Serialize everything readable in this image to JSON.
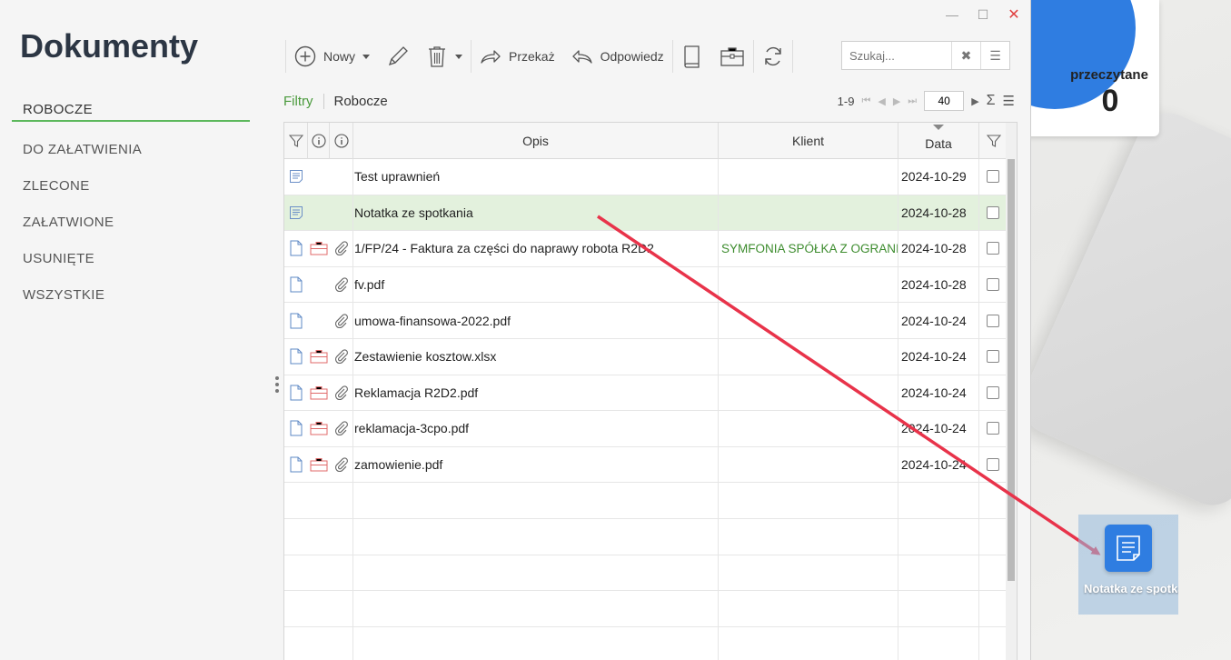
{
  "window": {
    "title": "Dokumenty",
    "controls": {
      "minimize": "—",
      "maximize": "☐",
      "close": "✕"
    }
  },
  "nav": {
    "items": [
      {
        "label": "ROBOCZE",
        "active": true
      },
      {
        "label": "DO ZAŁATWIENIA"
      },
      {
        "label": "ZLECONE"
      },
      {
        "label": "ZAŁATWIONE"
      },
      {
        "label": "USUNIĘTE"
      },
      {
        "label": "WSZYSTKIE"
      }
    ]
  },
  "toolbar": {
    "new_label": "Nowy",
    "forward_label": "Przekaż",
    "reply_label": "Odpowiedz",
    "icons": [
      "add-circle-icon",
      "pencil-icon",
      "trash-icon",
      "forward-arrow-icon",
      "reply-arrow-icon",
      "book-icon",
      "briefcase-icon",
      "refresh-icon"
    ]
  },
  "search": {
    "placeholder": "Szukaj...",
    "value": ""
  },
  "filterbar": {
    "filters_label": "Filtry",
    "view_label": "Robocze"
  },
  "pager": {
    "range": "1-9",
    "page_size": "40",
    "sum_symbol": "Σ"
  },
  "grid": {
    "columns": {
      "opis": "Opis",
      "klient": "Klient",
      "data": "Data"
    },
    "rows": [
      {
        "type": "note",
        "case": false,
        "attach": false,
        "opis": "Test uprawnień",
        "klient": "",
        "data": "2024-10-29"
      },
      {
        "type": "note",
        "case": false,
        "attach": false,
        "opis": "Notatka ze spotkania",
        "klient": "",
        "data": "2024-10-28",
        "selected": true
      },
      {
        "type": "doc",
        "case": true,
        "attach": true,
        "opis": "1/FP/24 - Faktura za części do naprawy robota R2D2",
        "klient": "SYMFONIA SPÓŁKA Z OGRANICZONĄ",
        "data": "2024-10-28"
      },
      {
        "type": "doc",
        "case": false,
        "attach": true,
        "opis": "fv.pdf",
        "klient": "",
        "data": "2024-10-28"
      },
      {
        "type": "doc",
        "case": false,
        "attach": true,
        "opis": "umowa-finansowa-2022.pdf",
        "klient": "",
        "data": "2024-10-24"
      },
      {
        "type": "doc",
        "case": true,
        "attach": true,
        "opis": "Zestawienie kosztow.xlsx",
        "klient": "",
        "data": "2024-10-24"
      },
      {
        "type": "doc",
        "case": true,
        "attach": true,
        "opis": "Reklamacja R2D2.pdf",
        "klient": "",
        "data": "2024-10-24"
      },
      {
        "type": "doc",
        "case": true,
        "attach": true,
        "opis": "reklamacja-3cpo.pdf",
        "klient": "",
        "data": "2024-10-24"
      },
      {
        "type": "doc",
        "case": true,
        "attach": true,
        "opis": "zamowienie.pdf",
        "klient": "",
        "data": "2024-10-24"
      }
    ]
  },
  "widget": {
    "label": "Nieprzeczytane",
    "visible_label": "przeczytane",
    "count": "0"
  },
  "drag_ghost": {
    "label": "Notatka ze spotkania"
  },
  "colors": {
    "accent_green": "#5cb85c",
    "brand_blue": "#2f7de1",
    "drag_arrow": "#e8334a",
    "selected_row": "#e3f1dd"
  }
}
